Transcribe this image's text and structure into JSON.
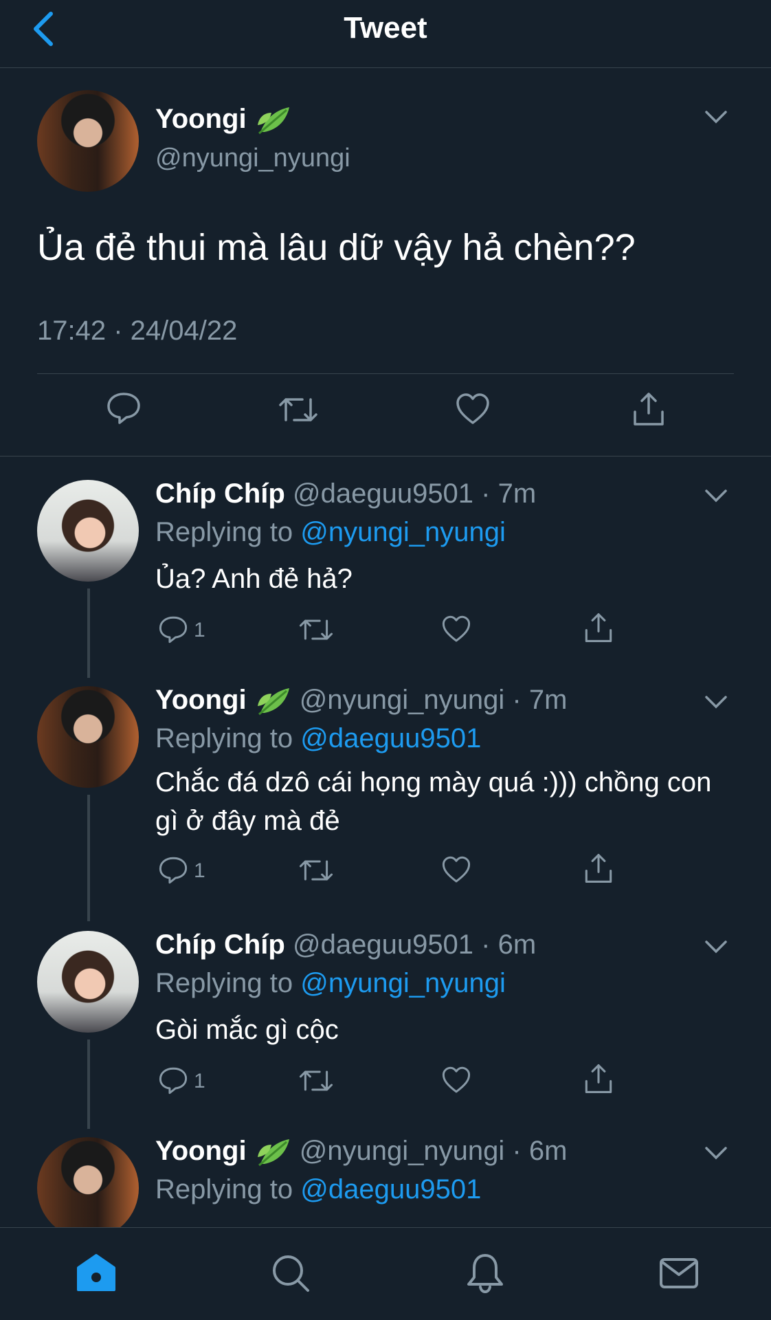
{
  "header": {
    "title": "Tweet"
  },
  "main_tweet": {
    "name": "Yoongi",
    "handle": "@nyungi_nyungi",
    "text": "Ủa đẻ thui mà lâu dữ vậy hả chèn??",
    "timestamp": "17:42 · 24/04/22"
  },
  "replies": [
    {
      "name": "Chíp Chíp",
      "handle": "@daeguu9501",
      "time": "7m",
      "replying_label": "Replying to",
      "replying_to": "@nyungi_nyungi",
      "text": "Ủa? Anh đẻ hả?",
      "reply_count": "1"
    },
    {
      "name": "Yoongi",
      "handle": "@nyungi_nyungi",
      "time": "7m",
      "replying_label": "Replying to",
      "replying_to": "@daeguu9501",
      "text": "Chắc đá dzô cái họng mày quá :))) chồng con gì ở đây mà đẻ",
      "reply_count": "1"
    },
    {
      "name": "Chíp Chíp",
      "handle": "@daeguu9501",
      "time": "6m",
      "replying_label": "Replying to",
      "replying_to": "@nyungi_nyungi",
      "text": "Gòi mắc gì cộc",
      "reply_count": "1"
    },
    {
      "name": "Yoongi",
      "handle": "@nyungi_nyungi",
      "time": "6m",
      "replying_label": "Replying to",
      "replying_to": "@daeguu9501",
      "text": ""
    }
  ],
  "colors": {
    "background": "#15202b",
    "accent": "#1d9bf0",
    "muted": "#8899a6",
    "border": "#38444d"
  },
  "icons": [
    "back-icon",
    "leaf-emoji-icon",
    "chevron-down-icon",
    "reply-icon",
    "retweet-icon",
    "like-icon",
    "share-icon",
    "home-icon",
    "search-icon",
    "bell-icon",
    "mail-icon"
  ]
}
